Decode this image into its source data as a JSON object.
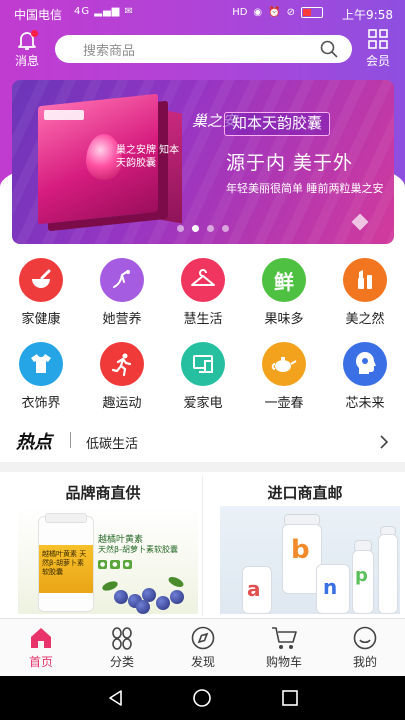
{
  "status_bar": {
    "carrier": "中国电信",
    "network": "4G",
    "time": "上午9:58",
    "battery_color": "#ff3b3b"
  },
  "header": {
    "message_label": "消息",
    "member_label": "会员",
    "search_placeholder": "搜索商品"
  },
  "banner": {
    "brand_script": "巢之安",
    "pack_text": "巢之安牌 知本天韵胶囊",
    "tagline": "知本天韵胶囊",
    "headline": "源于内  美于外",
    "subline": "年轻美丽很简单  睡前两粒巢之安",
    "page_count": 4,
    "active_page": 1
  },
  "categories": [
    {
      "label": "家健康",
      "icon": "mortar-pestle-icon",
      "color": "#ee3b3b"
    },
    {
      "label": "她营养",
      "icon": "fairy-icon",
      "color": "#a65ce0"
    },
    {
      "label": "慧生活",
      "icon": "hanger-icon",
      "color": "#f0355e"
    },
    {
      "label": "果味多",
      "icon": "fresh-icon",
      "color": "#4fc142"
    },
    {
      "label": "美之然",
      "icon": "makeup-icon",
      "color": "#f2761f"
    },
    {
      "label": "衣饰界",
      "icon": "tshirt-icon",
      "color": "#25a5e6"
    },
    {
      "label": "趣运动",
      "icon": "running-icon",
      "color": "#f03a3a"
    },
    {
      "label": "爱家电",
      "icon": "appliance-icon",
      "color": "#26c0a0"
    },
    {
      "label": "一壶春",
      "icon": "teapot-icon",
      "color": "#f3a21e"
    },
    {
      "label": "芯未来",
      "icon": "brain-head-icon",
      "color": "#3a6fe5"
    }
  ],
  "hot": {
    "title": "热点",
    "text": "低碳生活"
  },
  "panels": {
    "left_title": "品牌商直供",
    "right_title": "进口商直邮",
    "left_promo_1": "越橘叶黄素",
    "left_promo_2": "天然β-胡萝卜素软胶囊",
    "left_bottle_text": "越橘叶黄素 天然β-胡萝卜素软胶囊"
  },
  "tabbar": [
    {
      "label": "首页",
      "icon": "home-icon",
      "active": true
    },
    {
      "label": "分类",
      "icon": "category-icon",
      "active": false
    },
    {
      "label": "发现",
      "icon": "compass-icon",
      "active": false
    },
    {
      "label": "购物车",
      "icon": "cart-icon",
      "active": false
    },
    {
      "label": "我的",
      "icon": "smile-icon",
      "active": false
    }
  ],
  "colors": {
    "header_gradient_start": "#c13bd0",
    "header_gradient_end": "#8e4fe0",
    "accent": "#e8336b"
  }
}
